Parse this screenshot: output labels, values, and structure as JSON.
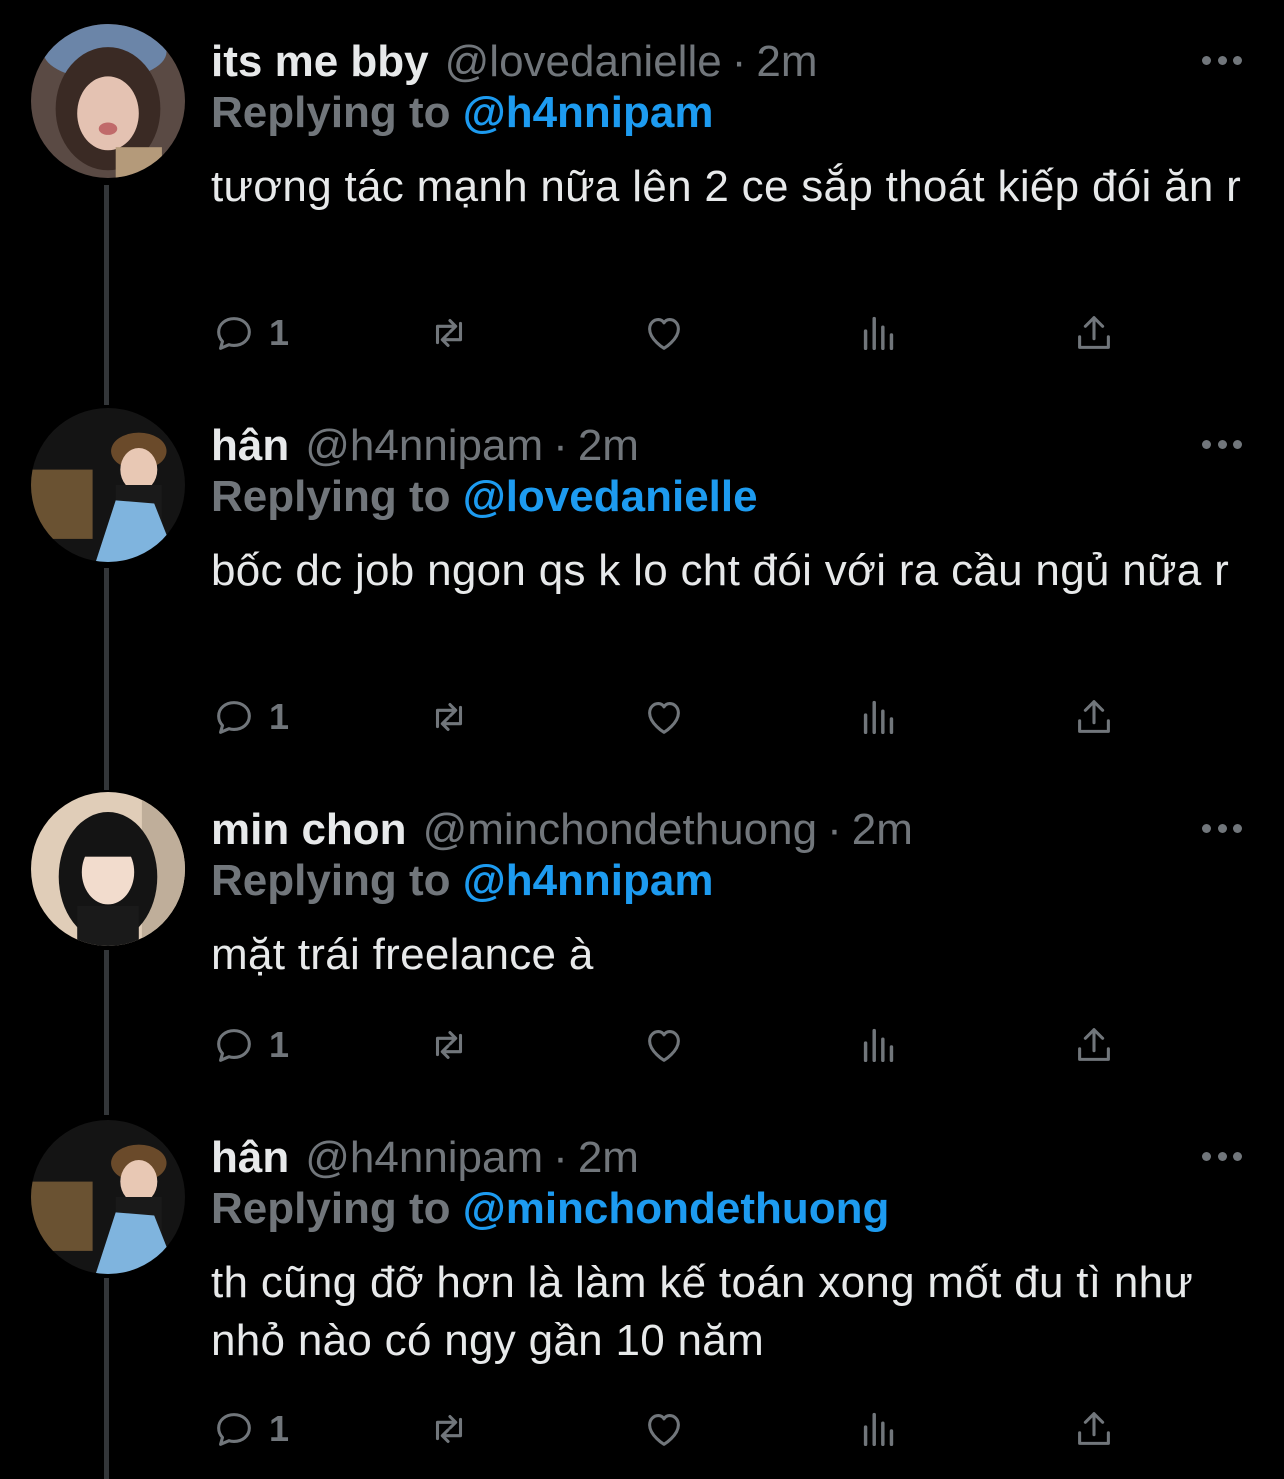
{
  "tweets": [
    {
      "name": "its me bby",
      "handle": "@lovedanielle",
      "dot": "·",
      "time": "2m",
      "replying_prefix": "Replying to",
      "replying_to": "@h4nnipam",
      "text": "tương tác mạnh nữa lên 2 ce sắp thoát kiếp đói ăn r",
      "reply_count": "1"
    },
    {
      "name": "hân",
      "handle": "@h4nnipam",
      "dot": "·",
      "time": "2m",
      "replying_prefix": "Replying to",
      "replying_to": "@lovedanielle",
      "text": "bốc dc job ngon qs k lo cht đói với ra cầu ngủ nữa r",
      "reply_count": "1"
    },
    {
      "name": "min chon",
      "handle": "@minchondethuong",
      "dot": "·",
      "time": "2m",
      "replying_prefix": "Replying to",
      "replying_to": "@h4nnipam",
      "text": "mặt trái freelance à",
      "reply_count": "1"
    },
    {
      "name": "hân",
      "handle": "@h4nnipam",
      "dot": "·",
      "time": "2m",
      "replying_prefix": "Replying to",
      "replying_to": "@minchondethuong",
      "text": "th cũng đỡ hơn là làm kế toán xong mốt đu tì như nhỏ nào có ngy gần 10 năm",
      "reply_count": "1"
    }
  ],
  "icons": {
    "reply": "reply-icon",
    "retweet": "retweet-icon",
    "like": "heart-icon",
    "views": "views-icon",
    "share": "share-icon",
    "more": "more-icon"
  },
  "colors": {
    "background": "#000000",
    "primary_text": "#e7e9ea",
    "secondary_text": "#71767b",
    "mention": "#1d9bf0",
    "thread_line": "#333639"
  }
}
